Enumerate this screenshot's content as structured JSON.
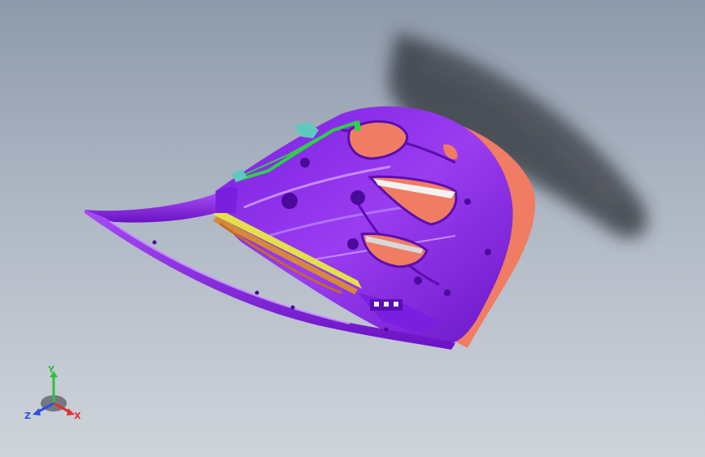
{
  "viewport": {
    "background_top": "#8e9aab",
    "background_bottom": "#cfd4db"
  },
  "model": {
    "part": "car-door-inner-panel",
    "main_color": "#8a2be2",
    "accent_orange": "#f07c63",
    "accent_green": "#2fd04a",
    "accent_yellow": "#e4e04a",
    "accent_teal": "#5ec9c0"
  },
  "triad": {
    "x_label": "X",
    "y_label": "Y",
    "z_label": "Z",
    "x_color": "#e03030",
    "y_color": "#2fbf3f",
    "z_color": "#2f4fe0"
  }
}
